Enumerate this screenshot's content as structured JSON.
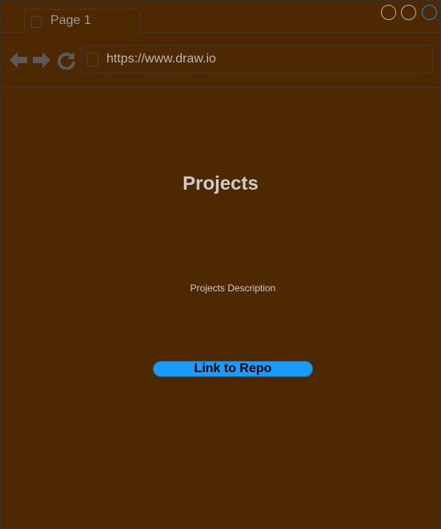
{
  "browser": {
    "tab": {
      "label": "Page 1"
    },
    "address_bar": {
      "url": "https://www.draw.io"
    },
    "nav": {
      "back_icon": "arrow-left-icon",
      "forward_icon": "arrow-right-icon",
      "refresh_icon": "refresh-icon"
    },
    "window_controls": [
      "minimize-icon",
      "maximize-icon",
      "close-icon"
    ]
  },
  "content": {
    "title": "Projects",
    "description": "Projects Description",
    "repo_button_label": "Link to Repo"
  },
  "colors": {
    "background": "#4d2800",
    "accent_button": "#1a9cff",
    "close_control": "#1a8ce0",
    "text_light": "#cccccc"
  }
}
